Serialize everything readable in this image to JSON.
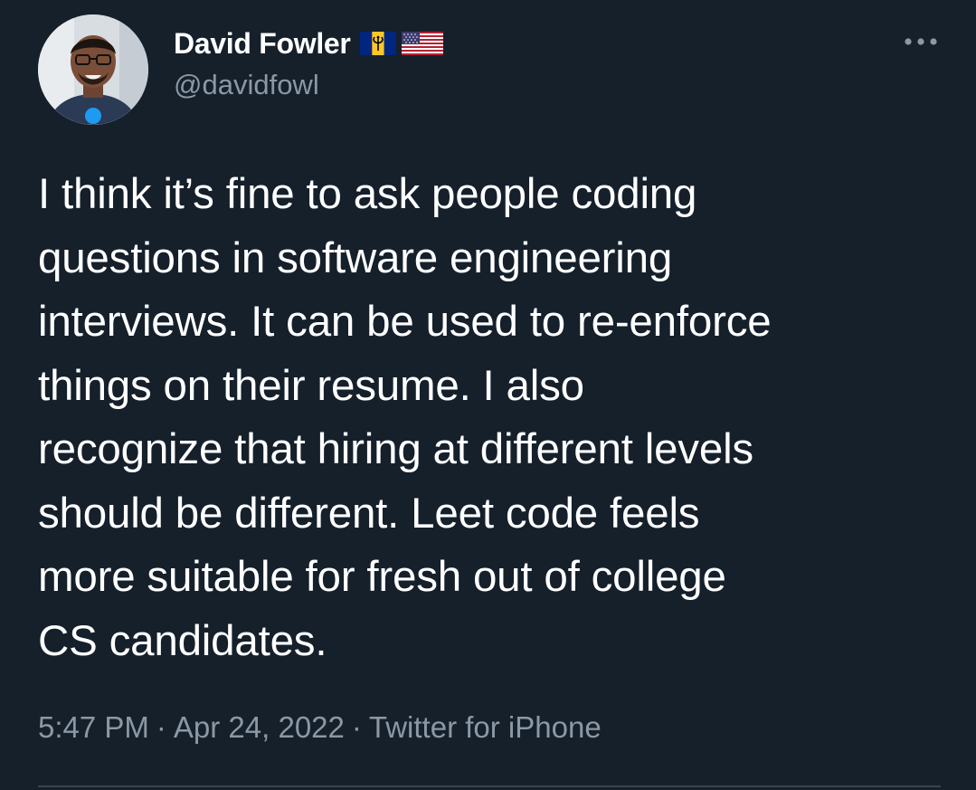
{
  "author": {
    "display_name": "David Fowler",
    "handle": "@davidfowl",
    "flags": [
      "barbados-flag-icon",
      "usa-flag-icon"
    ],
    "avatar": "avatar-photo"
  },
  "tweet": {
    "text": "I think it’s fine to ask people coding\nquestions in software engineering\ninterviews. It can be used to re-enforce\nthings on their resume. I also\nrecognize that hiring at different levels\nshould be different. Leet code feels\nmore suitable for fresh out of college\nCS candidates."
  },
  "meta": {
    "time": "5:47 PM",
    "separator": "·",
    "date": "Apr 24, 2022",
    "source": "Twitter for iPhone"
  },
  "icons": {
    "more": "more-options-icon"
  },
  "colors": {
    "background": "#15202b",
    "text": "#ffffff",
    "secondary_text": "#8b98a5",
    "divider": "#38444d"
  }
}
